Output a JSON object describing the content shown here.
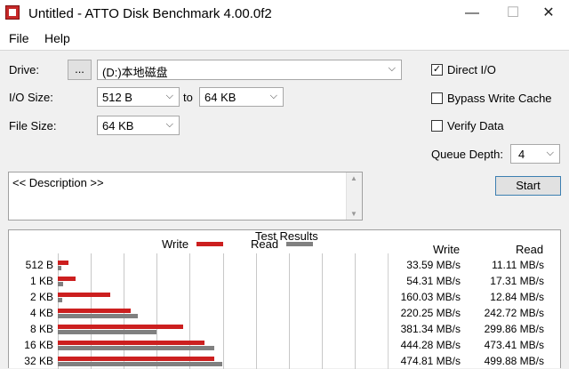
{
  "window": {
    "title": "Untitled - ATTO Disk Benchmark 4.00.0f2",
    "minimize": "—",
    "maximize": "☐",
    "close": "✕"
  },
  "menu": {
    "file": "File",
    "help": "Help"
  },
  "form": {
    "drive_label": "Drive:",
    "browse_label": "...",
    "drive_value": "(D:)本地磁盘",
    "io_size_label": "I/O Size:",
    "io_from": "512 B",
    "to_label": "to",
    "io_to": "64 KB",
    "file_size_label": "File Size:",
    "file_size": "64 KB",
    "direct_io_label": "Direct I/O",
    "direct_io_checked": true,
    "bypass_label": "Bypass Write Cache",
    "bypass_checked": false,
    "verify_label": "Verify Data",
    "verify_checked": false,
    "queue_label": "Queue Depth:",
    "queue_value": "4",
    "start_label": "Start",
    "description": "<< Description >>",
    "arrow": "⌵"
  },
  "chart_data": {
    "type": "bar",
    "title": "Test Results",
    "categories": [
      "512 B",
      "1 KB",
      "2 KB",
      "4 KB",
      "8 KB",
      "16 KB",
      "32 KB"
    ],
    "x_max_mbps": 1000,
    "series": [
      {
        "name": "Write",
        "color": "#cc1f1f",
        "values": [
          33.59,
          54.31,
          160.03,
          220.25,
          381.34,
          444.28,
          474.81
        ]
      },
      {
        "name": "Read",
        "color": "#808080",
        "values": [
          11.11,
          17.31,
          12.84,
          242.72,
          299.86,
          473.41,
          499.88
        ]
      }
    ],
    "write_header": "Write",
    "read_header": "Read",
    "write_text": [
      "33.59 MB/s",
      "54.31 MB/s",
      "160.03 MB/s",
      "220.25 MB/s",
      "381.34 MB/s",
      "444.28 MB/s",
      "474.81 MB/s"
    ],
    "read_text": [
      "11.11 MB/s",
      "17.31 MB/s",
      "12.84 MB/s",
      "242.72 MB/s",
      "299.86 MB/s",
      "473.41 MB/s",
      "499.88 MB/s"
    ]
  }
}
